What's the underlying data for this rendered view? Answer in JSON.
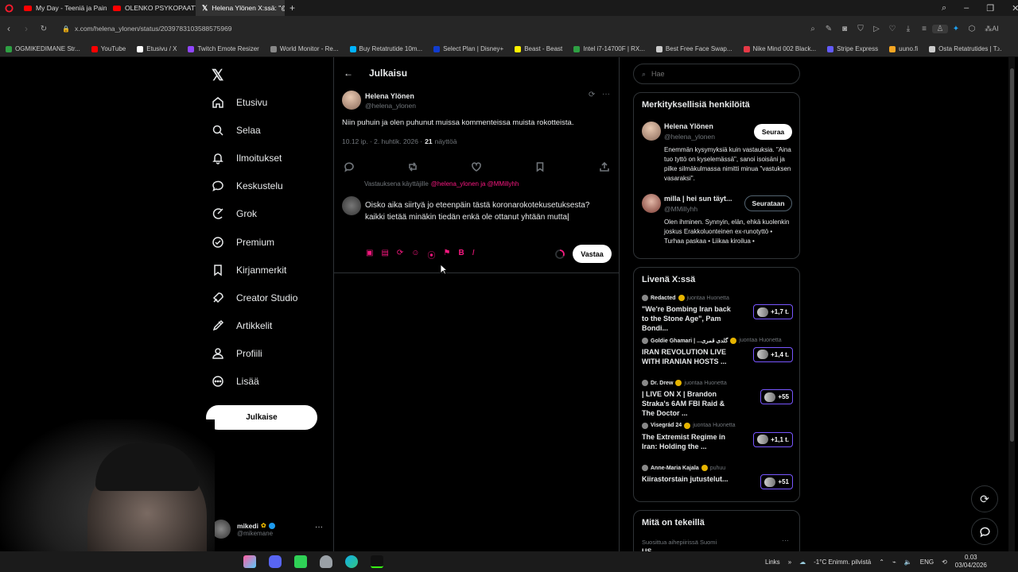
{
  "browser": {
    "tabs": [
      {
        "label": "My Day - Teeniä ja Painit"
      },
      {
        "label": "OLENKO PSYKOPAATTI? Fr"
      },
      {
        "label": "Helena Ylönen X:ssä: \"@M"
      }
    ],
    "new_tab": "+",
    "url": "x.com/helena_ylonen/status/2039783103588575969",
    "bookmarks": [
      {
        "label": "OGMIKEDIMANE Str...",
        "color": "#2ea043"
      },
      {
        "label": "YouTube",
        "color": "#ff0000"
      },
      {
        "label": "Etusivu / X",
        "color": "#ffffff"
      },
      {
        "label": "Twitch Emote Resizer",
        "color": "#9146ff"
      },
      {
        "label": "World Monitor - Re...",
        "color": "#888888"
      },
      {
        "label": "Buy Retatrutide 10m...",
        "color": "#00b3ff"
      },
      {
        "label": "Select Plan | Disney+",
        "color": "#113ccf"
      },
      {
        "label": "Beast - Beast",
        "color": "#fff200"
      },
      {
        "label": "Intel i7-14700F | RX...",
        "color": "#2ea043"
      },
      {
        "label": "Best Free Face Swap...",
        "color": "#cccccc"
      },
      {
        "label": "Nike Mind 002 Black...",
        "color": "#e63946"
      },
      {
        "label": "Stripe Express",
        "color": "#635bff"
      },
      {
        "label": "uuno.fi",
        "color": "#f5a623"
      },
      {
        "label": "Osta Retatrutides | T...",
        "color": "#cccccc"
      }
    ]
  },
  "nav": {
    "items": [
      {
        "label": "Etusivu",
        "icon": "home-icon"
      },
      {
        "label": "Selaa",
        "icon": "search-icon"
      },
      {
        "label": "Ilmoitukset",
        "icon": "bell-icon"
      },
      {
        "label": "Keskustelu",
        "icon": "chat-icon"
      },
      {
        "label": "Grok",
        "icon": "grok-icon"
      },
      {
        "label": "Premium",
        "icon": "verified-icon"
      },
      {
        "label": "Kirjanmerkit",
        "icon": "bookmark-icon"
      },
      {
        "label": "Creator Studio",
        "icon": "rocket-icon"
      },
      {
        "label": "Artikkelit",
        "icon": "article-icon"
      },
      {
        "label": "Profiili",
        "icon": "person-icon"
      },
      {
        "label": "Lisää",
        "icon": "more-circle-icon"
      }
    ],
    "post_label": "Julkaise",
    "account_name": "mikedi",
    "account_handle": "@mikemane"
  },
  "post": {
    "header_title": "Julkaisu",
    "author_name": "Helena Ylönen",
    "author_handle": "@helena_ylonen",
    "text": "Niin puhuin ja olen puhunut muissa kommenteissa muista rokotteista.",
    "time": "10.12 ip. · 2. huhtik. 2026 ·",
    "views_count": "21",
    "views_label": "näyttöä",
    "reply_to_prefix": "Vastauksena käyttäjille",
    "reply_to_users": "@helena_ylonen ja @MMillyhh",
    "draft": "Oisko aika siirtyä jo eteenpäin tästä koronarokotekusetuksesta? kaikki tietää minäkin tiedän enkä ole ottanut yhtään mutta",
    "reply_button": "Vastaa"
  },
  "search": {
    "placeholder": "Hae"
  },
  "people": {
    "title": "Merkityksellisiä henkilöitä",
    "items": [
      {
        "name": "Helena Ylönen",
        "handle": "@helena_ylonen",
        "bio": "Enemmän kysymyksiä kuin vastauksia. \"Aina tuo tyttö on kyselemässä\", sanoi isoisäni ja pilke silmäkulmassa nimitti minua \"vastuksen vasaraksi\".",
        "button": "Seuraa"
      },
      {
        "name": "milla | hei sun täyt...",
        "handle": "@MMillyhh",
        "bio": "Olen ihminen. Synnyin, elän, ehkä kuolenkin joskus Erakkoluonteinen ex-runotyttö • Turhaa paskaa • Liikaa kiroilua •",
        "button": "Seurataan"
      }
    ]
  },
  "live": {
    "title": "Livenä X:ssä",
    "items": [
      {
        "source": "Redacted",
        "action": "juontaa Huonetta",
        "title": "\"We're Bombing Iran back to the Stone Age\", Pam Bondi...",
        "badge": "+1,7 t."
      },
      {
        "source": "Goldie Ghamari | ...گلدی قمری",
        "action": "juontaa Huonetta",
        "title": "IRAN REVOLUTION LIVE WITH IRANIAN HOSTS ...",
        "badge": "+1,4 t."
      },
      {
        "source": "Dr. Drew",
        "action": "juontaa Huonetta",
        "title": "| LIVE ON X | Brandon Straka's 6AM FBI Raid & The Doctor ...",
        "badge": "+55"
      },
      {
        "source": "Visegrád 24",
        "action": "juontaa Huonetta",
        "title": "The Extremist Regime in Iran: Holding the ...",
        "badge": "+1,1 t."
      },
      {
        "source": "Anne-Maria Kajala",
        "action": "puhuu",
        "title": "Kiirastorstain jutustelut...",
        "badge": "+51"
      }
    ]
  },
  "trending": {
    "title": "Mitä on tekeillä",
    "subtitle": "Suosittua aihepiirissä Suomi",
    "first": "US"
  },
  "taskbar": {
    "links": "Links",
    "weather": "-1°C  Enimm. pilvistä",
    "lang": "ENG",
    "time": "0.03",
    "date": "03/04/2026"
  }
}
